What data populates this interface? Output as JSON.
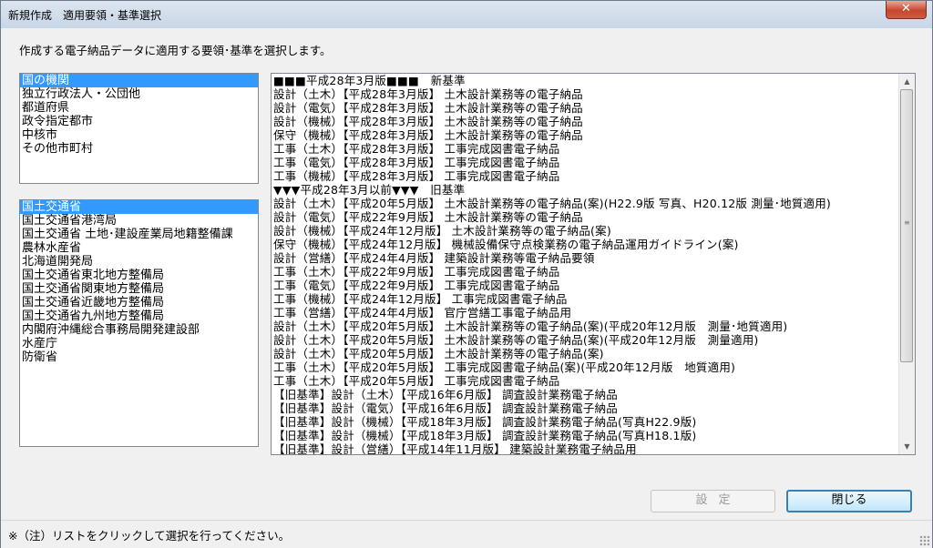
{
  "window": {
    "title": "新規作成　適用要領・基準選択",
    "close_glyph": "✕"
  },
  "instruction": "作成する電子納品データに適用する要領･基準を選択します。",
  "org_list": {
    "items": [
      "国の機関",
      "独立行政法人・公団他",
      "都道府県",
      "政令指定都市",
      "中核市",
      "その他市町村"
    ],
    "selected_index": 0
  },
  "agency_list": {
    "items": [
      "国土交通省",
      "国土交通省港湾局",
      "国土交通省 土地･建設産業局地籍整備課",
      "農林水産省",
      "北海道開発局",
      "国土交通省東北地方整備局",
      "国土交通省関東地方整備局",
      "国土交通省近畿地方整備局",
      "国土交通省九州地方整備局",
      "内閣府沖縄総合事務局開発建設部",
      "水産庁",
      "防衛省"
    ],
    "selected_index": 0
  },
  "standards_list": {
    "items": [
      "■■■平成28年3月版■■■　新基準",
      "設計（土木）【平成28年3月版】 土木設計業務等の電子納品",
      "設計（電気）【平成28年3月版】 土木設計業務等の電子納品",
      "設計（機械）【平成28年3月版】 土木設計業務等の電子納品",
      "保守（機械）【平成28年3月版】 土木設計業務等の電子納品",
      "工事（土木）【平成28年3月版】 工事完成図書電子納品",
      "工事（電気）【平成28年3月版】 工事完成図書電子納品",
      "工事（機械）【平成28年3月版】 工事完成図書電子納品",
      "▼▼▼平成28年3月以前▼▼▼　旧基準",
      "設計（土木）【平成20年5月版】 土木設計業務等の電子納品(案)(H22.9版 写真、H20.12版 測量･地質適用)",
      "設計（電気）【平成22年9月版】 土木設計業務等の電子納品",
      "設計（機械）【平成24年12月版】 土木設計業務等の電子納品(案)",
      "保守（機械）【平成24年12月版】 機械設備保守点検業務の電子納品運用ガイドライン(案)",
      "設計（営繕）【平成24年4月版】 建築設計業務等電子納品要領",
      "工事（土木）【平成22年9月版】 工事完成図書電子納品",
      "工事（電気）【平成22年9月版】 工事完成図書電子納品",
      "工事（機械）【平成24年12月版】 工事完成図書電子納品",
      "工事（営繕）【平成24年4月版】 官庁営繕工事電子納品用",
      "設計（土木）【平成20年5月版】 土木設計業務等の電子納品(案)(平成20年12月版　測量･地質適用)",
      "設計（土木）【平成20年5月版】 土木設計業務等の電子納品(案)(平成20年12月版　測量適用)",
      "設計（土木）【平成20年5月版】 土木設計業務等の電子納品(案)",
      "工事（土木）【平成20年5月版】 工事完成図書電子納品(案)(平成20年12月版　地質適用)",
      "工事（土木）【平成20年5月版】 工事完成図書電子納品",
      "【旧基準】設計（土木）【平成16年6月版】 調査設計業務電子納品",
      "【旧基準】設計（電気）【平成16年6月版】 調査設計業務電子納品",
      "【旧基準】設計（機械）【平成18年3月版】 調査設計業務電子納品(写真H22.9版)",
      "【旧基準】設計（機械）【平成18年3月版】 調査設計業務電子納品(写真H18.1版)",
      "【旧基準】設計（営繕）【平成14年11月版】 建築設計業務電子納品用"
    ],
    "scroll_up_glyph": "▲",
    "scroll_down_glyph": "▼",
    "grip_glyph": "≡"
  },
  "buttons": {
    "set_label": "設定",
    "close_label": "閉じる"
  },
  "status": "※（注）リストをクリックして選択を行ってください。"
}
